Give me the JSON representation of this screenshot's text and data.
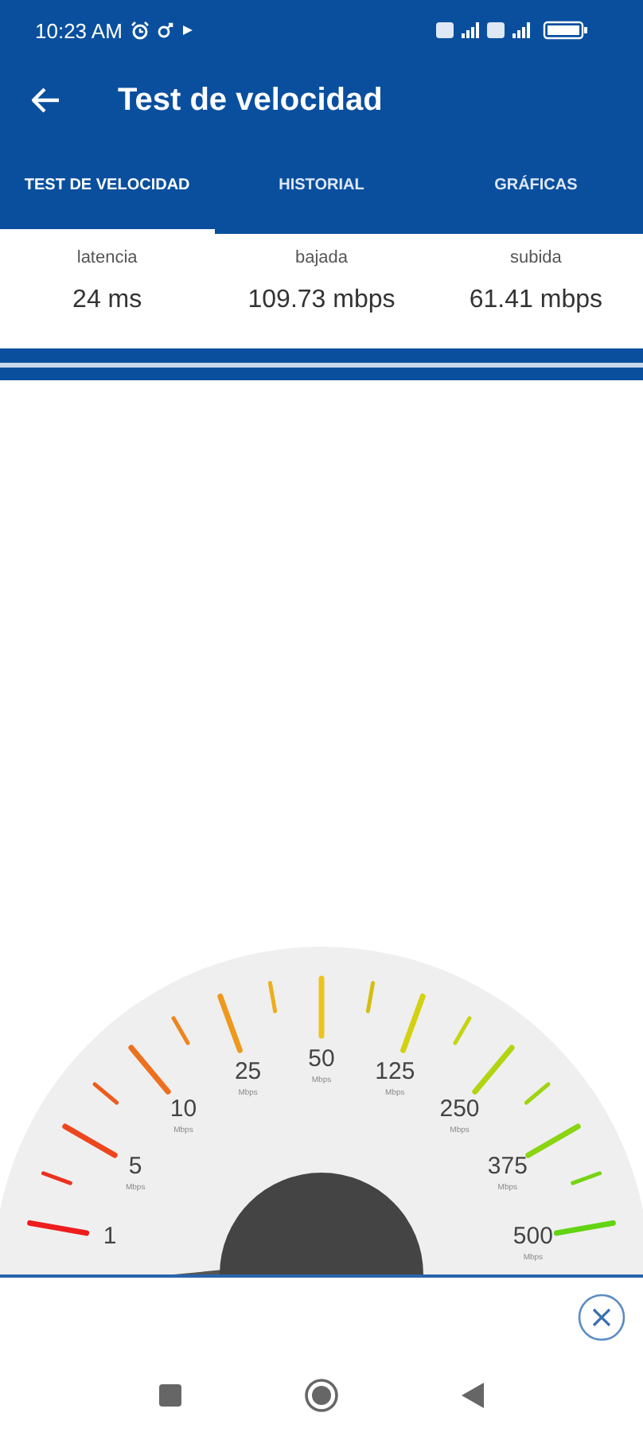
{
  "status_bar": {
    "time": "10:23 AM"
  },
  "toolbar": {
    "title": "Test de velocidad"
  },
  "tabs": [
    {
      "label": "TEST DE VELOCIDAD",
      "selected": true
    },
    {
      "label": "HISTORIAL",
      "selected": false
    },
    {
      "label": "GRÁFICAS",
      "selected": false
    }
  ],
  "stats": [
    {
      "label": "latencia",
      "value": "24 ms"
    },
    {
      "label": "bajada",
      "value": "109.73 mbps"
    },
    {
      "label": "subida",
      "value": "61.41 mbps"
    }
  ],
  "gauge": {
    "labels": [
      {
        "value": "1"
      },
      {
        "value": "5",
        "unit": "Mbps"
      },
      {
        "value": "10",
        "unit": "Mbps"
      },
      {
        "value": "25",
        "unit": "Mbps"
      },
      {
        "value": "50",
        "unit": "Mbps"
      },
      {
        "value": "125",
        "unit": "Mbps"
      },
      {
        "value": "250",
        "unit": "Mbps"
      },
      {
        "value": "375",
        "unit": "Mbps"
      },
      {
        "value": "500",
        "unit": "Mbps"
      }
    ]
  }
}
